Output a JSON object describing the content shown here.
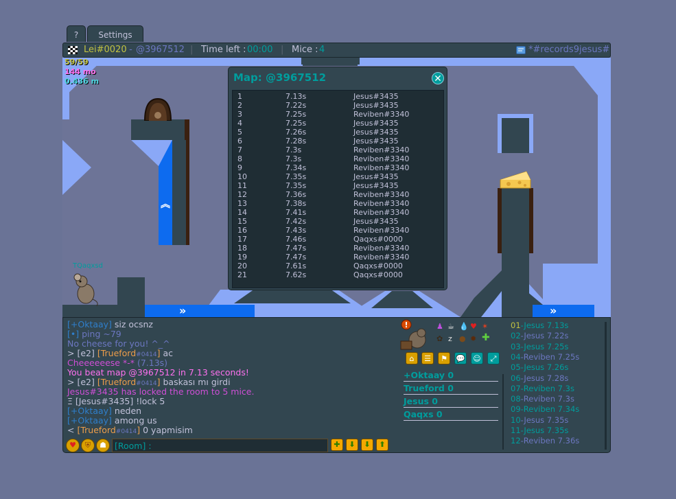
{
  "tabs": {
    "help": "?",
    "settings": "Settings"
  },
  "topbar": {
    "player": "Lei#0020",
    "map_sep": " - ",
    "map_code": "@3967512",
    "time_label": "Time left : ",
    "time_value": "00:00",
    "mice_label": "Mice : ",
    "mice_value": "4",
    "room": "*#records9jesus#"
  },
  "game": {
    "fps": "59/59",
    "distance": "144 mo",
    "speed": "0.436 m",
    "mouse_name": "TQaqxsd"
  },
  "map_window": {
    "title": "Map: @3967512",
    "close": "✕",
    "records": [
      {
        "rank": "1",
        "time": "7.13s",
        "player": "Jesus#3435"
      },
      {
        "rank": "2",
        "time": "7.22s",
        "player": "Jesus#3435"
      },
      {
        "rank": "3",
        "time": "7.25s",
        "player": "Reviben#3340"
      },
      {
        "rank": "4",
        "time": "7.25s",
        "player": "Jesus#3435"
      },
      {
        "rank": "5",
        "time": "7.26s",
        "player": "Jesus#3435"
      },
      {
        "rank": "6",
        "time": "7.28s",
        "player": "Jesus#3435"
      },
      {
        "rank": "7",
        "time": "7.3s",
        "player": "Reviben#3340"
      },
      {
        "rank": "8",
        "time": "7.3s",
        "player": "Reviben#3340"
      },
      {
        "rank": "9",
        "time": "7.34s",
        "player": "Reviben#3340"
      },
      {
        "rank": "10",
        "time": "7.35s",
        "player": "Jesus#3435"
      },
      {
        "rank": "11",
        "time": "7.35s",
        "player": "Jesus#3435"
      },
      {
        "rank": "12",
        "time": "7.36s",
        "player": "Reviben#3340"
      },
      {
        "rank": "13",
        "time": "7.38s",
        "player": "Reviben#3340"
      },
      {
        "rank": "14",
        "time": "7.41s",
        "player": "Reviben#3340"
      },
      {
        "rank": "15",
        "time": "7.42s",
        "player": "Jesus#3435"
      },
      {
        "rank": "16",
        "time": "7.43s",
        "player": "Reviben#3340"
      },
      {
        "rank": "17",
        "time": "7.46s",
        "player": "Qaqxs#0000"
      },
      {
        "rank": "18",
        "time": "7.47s",
        "player": "Reviben#3340"
      },
      {
        "rank": "19",
        "time": "7.47s",
        "player": "Reviben#3340"
      },
      {
        "rank": "20",
        "time": "7.61s",
        "player": "Qaqxs#0000"
      },
      {
        "rank": "21",
        "time": "7.62s",
        "player": "Qaqxs#0000"
      }
    ]
  },
  "chat": {
    "l1": {
      "name": "[+Oktaay]",
      "msg": " siz ocsnz"
    },
    "l2": {
      "name": "[•]",
      "msg": " ping ~79"
    },
    "l3": "No cheese for you! ^_^",
    "l4": {
      "pre": "> [e2] ",
      "name": "[Trueford",
      "tag": "#0414",
      "close": "]",
      "msg": " ac"
    },
    "l5": {
      "text": "Cheeeeeese *-* ",
      "time": "(7.13s)"
    },
    "l6": "You beat map @3967512 in 7.13 seconds!",
    "l7": {
      "pre": "> [e2] ",
      "name": "[Trueford",
      "tag": "#0414",
      "close": "]",
      "msg": " baskası mı girdi"
    },
    "l8": "Jesus#3435 has locked the room to 5 mice.",
    "l9": "Ξ [Jesus#3435] !lock 5",
    "l10": {
      "name": "[+Oktaay]",
      "msg": " neden"
    },
    "l11": {
      "name": "[+Oktaay]",
      "msg": " among us"
    },
    "l12": {
      "pre": "< ",
      "name": "[Trueford",
      "tag": "#0414",
      "close": "]",
      "msg": " 0 yapmisim"
    },
    "input_placeholder": "[Room] :"
  },
  "players": [
    {
      "name": "+Oktaay",
      "score": "0",
      "color": "#009d9d"
    },
    {
      "name": "Trueford",
      "score": "0",
      "color": "#009d9d"
    },
    {
      "name": "Jesus",
      "score": "0",
      "color": "#009d9d"
    },
    {
      "name": "Qaqxs",
      "score": "0",
      "color": "#009d9d"
    }
  ],
  "times": [
    {
      "pos": "01",
      "text": "-Jesus 7.13s"
    },
    {
      "pos": "02",
      "text": "-Jesus 7.22s"
    },
    {
      "pos": "03",
      "text": "-Jesus 7.25s"
    },
    {
      "pos": "04",
      "text": "-Reviben 7.25s"
    },
    {
      "pos": "05",
      "text": "-Jesus 7.26s"
    },
    {
      "pos": "06",
      "text": "-Jesus 7.28s"
    },
    {
      "pos": "07",
      "text": "-Reviben 7.3s"
    },
    {
      "pos": "08",
      "text": "-Reviben 7.3s"
    },
    {
      "pos": "09",
      "text": "-Reviben 7.34s"
    },
    {
      "pos": "10",
      "text": "-Jesus 7.35s"
    },
    {
      "pos": "11",
      "text": "-Jesus 7.35s"
    },
    {
      "pos": "12",
      "text": "-Reviben 7.36s"
    }
  ],
  "colors": {
    "accent": "#009d9d",
    "panel": "#324650",
    "chat_name": "#2f7fcc",
    "trueford": "#ed9d4a",
    "server": "#6c77c1",
    "violet": "#cf4fd6",
    "pink": "#fe71ef",
    "gold": "#c2c241"
  },
  "icons": [
    "flag-icon",
    "message-icon",
    "heart-icon",
    "shop-icon",
    "shaman-icon",
    "home-icon",
    "list-icon",
    "wardrobe-icon",
    "chat-icon",
    "discord-icon",
    "fullscreen-icon",
    "plus-icon",
    "down-icon",
    "up-icon"
  ]
}
